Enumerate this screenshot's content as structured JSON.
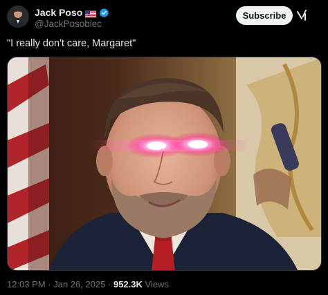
{
  "author": {
    "display_name": "Jack Poso",
    "handle": "@JackPosobiec",
    "flag_icon": "us-flag-icon",
    "verified_icon": "verified-badge-icon",
    "verified_color": "#1d9bf0"
  },
  "header": {
    "subscribe_label": "Subscribe",
    "grok_icon": "grok-icon"
  },
  "tweet": {
    "text": "\"I really don't care, Margaret\""
  },
  "meta": {
    "time": "12:03 PM",
    "separator_1": " · ",
    "date": "Jan 26, 2025",
    "separator_2": " · ",
    "views_count": "952.3K",
    "views_label": " Views"
  },
  "colors": {
    "background": "#000000",
    "text_primary": "#e7e9ea",
    "text_secondary": "#71767b",
    "button_bg": "#eff3f4",
    "button_text": "#0f1419"
  }
}
